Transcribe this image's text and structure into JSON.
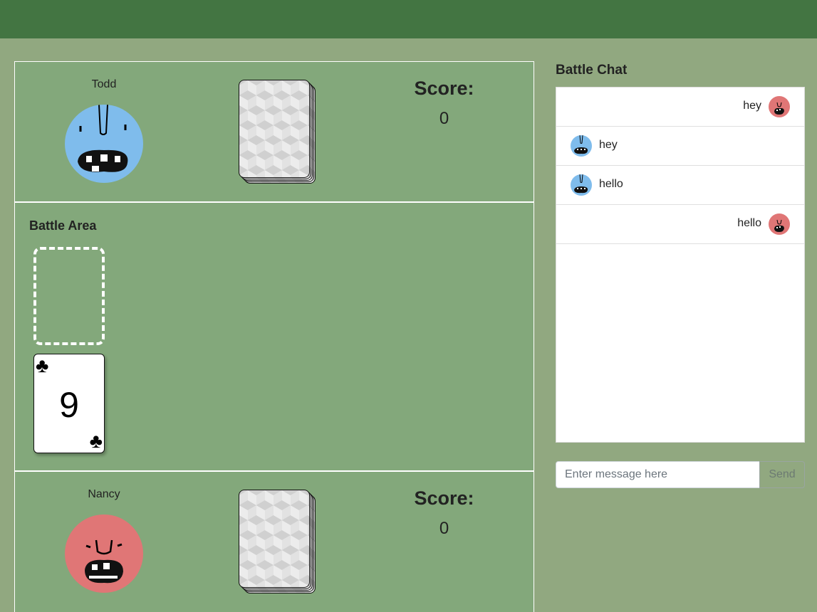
{
  "players": {
    "top": {
      "name": "Todd",
      "score_label": "Score:",
      "score": "0",
      "avatar_color": "#7fbcec"
    },
    "bottom": {
      "name": "Nancy",
      "score_label": "Score:",
      "score": "0",
      "avatar_color": "#e07676"
    }
  },
  "battle_area": {
    "title": "Battle Area",
    "played_card": {
      "rank": "9",
      "suit": "♣"
    }
  },
  "chat": {
    "title": "Battle Chat",
    "messages": [
      {
        "text": "hey",
        "side": "right",
        "avatar": "nancy-avatar-icon"
      },
      {
        "text": "hey",
        "side": "left",
        "avatar": "todd-avatar-icon"
      },
      {
        "text": "hello",
        "side": "left",
        "avatar": "todd-avatar-icon"
      },
      {
        "text": "hello",
        "side": "right",
        "avatar": "nancy-avatar-icon"
      }
    ],
    "input_placeholder": "Enter message here",
    "send_label": "Send"
  },
  "colors": {
    "topbar": "#437542",
    "background": "#91a880",
    "panel": "#83a87b",
    "todd": "#7fbcec",
    "nancy": "#e07676"
  }
}
